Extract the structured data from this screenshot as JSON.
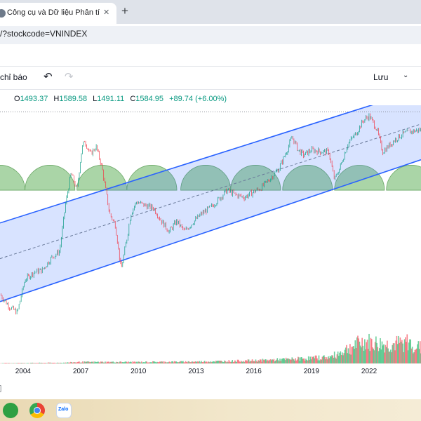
{
  "browser": {
    "tab_title": "Công cụ và Dữ liệu Phân tích kỹ",
    "close_glyph": "✕",
    "new_tab_glyph": "+",
    "address": "/?stockcode=VNINDEX"
  },
  "toolbar": {
    "indicators_label": "chỉ báo",
    "undo_glyph": "↶",
    "redo_glyph": "↷",
    "save_label": "Lưu",
    "save_chevron": "⌄"
  },
  "legend": {
    "open_key": "O",
    "open": "1493.37",
    "high_key": "H",
    "high": "1589.58",
    "low_key": "L",
    "low": "1491.11",
    "close_key": "C",
    "close": "1584.95",
    "change": "+89.74 (+6.00%)"
  },
  "colors": {
    "up": "#089981",
    "down": "#f23645",
    "channel_line": "#2962ff",
    "channel_fill": "#2962ff",
    "arc_fill": "#8dc78a"
  },
  "icons": {
    "tab_favicon": "site-favicon",
    "bottom_left": "calendar-icon",
    "taskbar": [
      "finance-app-icon",
      "chrome-icon",
      "zalo-icon"
    ]
  },
  "taskbar": {
    "zalo_label": "Zalo"
  },
  "chart_data": {
    "type": "line",
    "x_tick_labels": [
      "2004",
      "2007",
      "2010",
      "2013",
      "2016",
      "2019",
      "2022"
    ],
    "x_ticks": [
      2004,
      2007,
      2010,
      2013,
      2016,
      2019,
      2022
    ],
    "xlim": [
      2002.8,
      2024.7
    ],
    "ylim": [
      100,
      1700
    ],
    "y_scale": "log",
    "grid": false,
    "series": [
      {
        "x": [
          2002.8,
          2003.3,
          2003.7,
          2004.1,
          2004.6,
          2005.0,
          2005.5,
          2005.9,
          2006.2,
          2006.5,
          2006.8,
          2007.05,
          2007.2,
          2007.5,
          2007.8,
          2008.1,
          2008.5,
          2008.8,
          2009.1,
          2009.4,
          2009.6,
          2009.9,
          2010.3,
          2010.8,
          2011.2,
          2011.6,
          2012.0,
          2012.4,
          2012.8,
          2013.3,
          2013.8,
          2014.2,
          2014.6,
          2015.0,
          2015.5,
          2015.9,
          2016.4,
          2016.9,
          2017.3,
          2017.7,
          2018.0,
          2018.3,
          2018.6,
          2019.0,
          2019.5,
          2019.9,
          2020.2,
          2020.5,
          2020.9,
          2021.3,
          2021.7,
          2022.0,
          2022.4,
          2022.7,
          2022.9,
          2023.3,
          2023.7,
          2024.1,
          2024.7
        ],
        "values": [
          180,
          155,
          145,
          215,
          235,
          240,
          280,
          300,
          520,
          760,
          620,
          1000,
          1120,
          950,
          1040,
          820,
          470,
          410,
          240,
          350,
          470,
          540,
          520,
          500,
          430,
          380,
          430,
          380,
          420,
          470,
          510,
          560,
          620,
          590,
          570,
          600,
          640,
          720,
          800,
          980,
          1170,
          1000,
          940,
          1000,
          980,
          980,
          700,
          820,
          1080,
          1210,
          1420,
          1500,
          1280,
          980,
          1020,
          1120,
          1200,
          1240,
          1270
        ]
      }
    ],
    "channel": {
      "upper": {
        "x": [
          2002.8,
          2024.7
        ],
        "values": [
          420,
          2050
        ]
      },
      "lower": {
        "x": [
          2002.8,
          2024.7
        ],
        "values": [
          165,
          890
        ]
      },
      "mid": {
        "x": [
          2002.8,
          2024.7
        ],
        "values": [
          275,
          1360
        ]
      },
      "resistance_level": 1570
    },
    "cycle_arcs": {
      "centers": [
        2002.8,
        2005.4,
        2008.1,
        2010.7,
        2013.5,
        2016.1,
        2018.8,
        2021.5,
        2024.2
      ],
      "half_width_years": 1.3
    },
    "volume": {
      "note_x": [
        2002.8,
        2006.0,
        2007.0,
        2010.0,
        2013.0,
        2016.0,
        2018.0,
        2020.0,
        2021.0,
        2021.7,
        2022.3,
        2023.0,
        2024.0,
        2024.7
      ],
      "values": [
        0.01,
        0.02,
        0.04,
        0.04,
        0.05,
        0.08,
        0.12,
        0.18,
        0.45,
        0.6,
        0.55,
        0.5,
        0.58,
        0.42
      ]
    }
  }
}
